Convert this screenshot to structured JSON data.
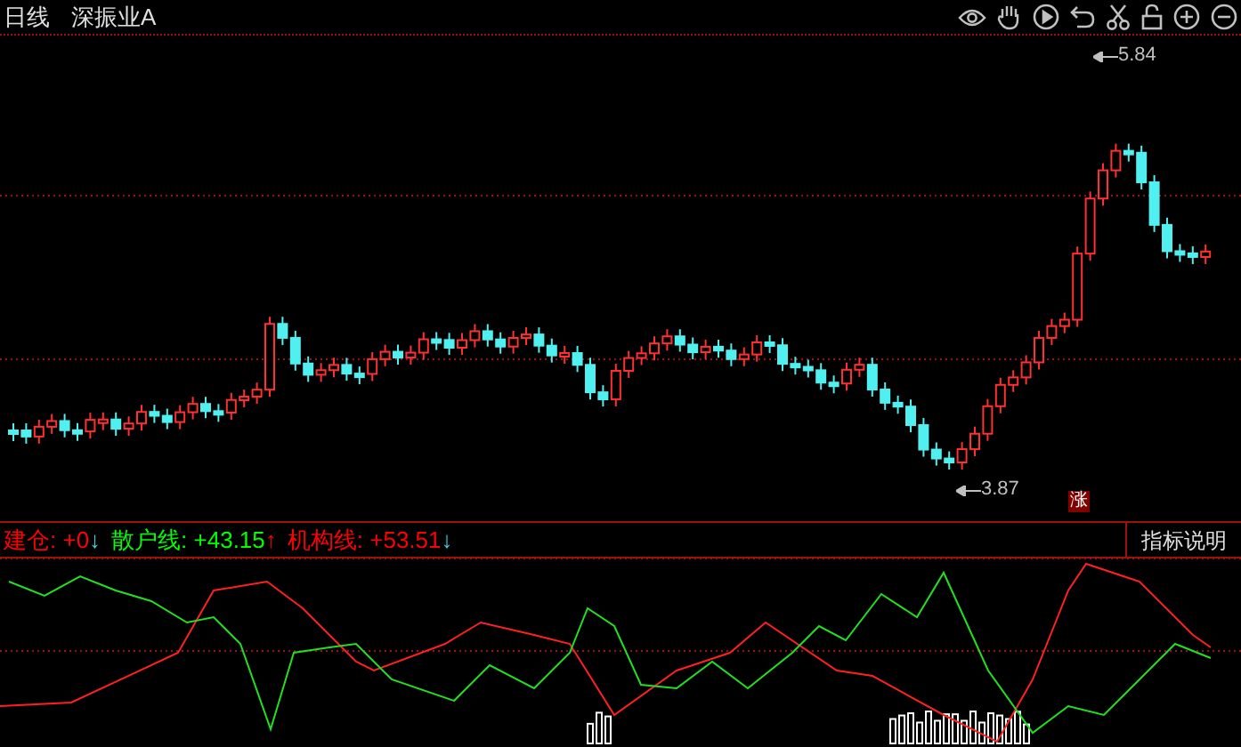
{
  "header": {
    "period": "日线",
    "stock": "深振业A"
  },
  "price_chart": {
    "high_label": "5.84",
    "low_label": "3.87",
    "badge": "涨"
  },
  "indicator": {
    "items": [
      {
        "label": "建仓:",
        "value": "+0",
        "color": "#ff0000",
        "arrow": {
          "text": "↓",
          "color": "#40d0e0"
        }
      },
      {
        "label": "散户线:",
        "value": "+43.15",
        "color": "#00ff00",
        "arrow": {
          "text": "↑",
          "color": "#ff0000"
        }
      },
      {
        "label": "机构线:",
        "value": "+53.51",
        "color": "#ff0000",
        "arrow": {
          "text": "↓",
          "color": "#40d0e0"
        }
      }
    ],
    "button": "指标说明"
  }
}
